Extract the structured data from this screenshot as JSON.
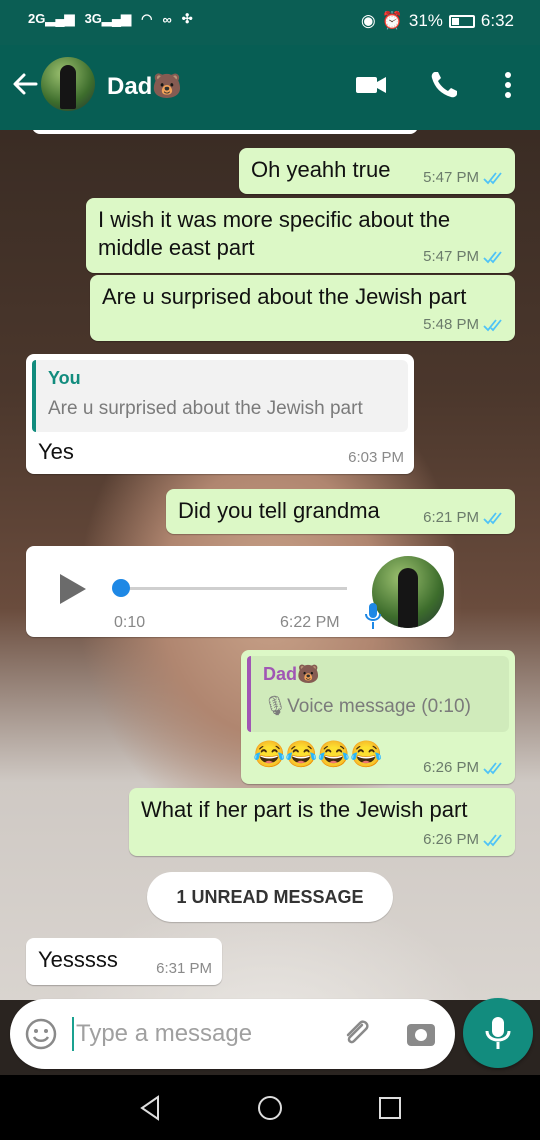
{
  "status_bar": {
    "network_left": "2G",
    "network_right": "3G",
    "battery": "31%",
    "time": "6:32"
  },
  "header": {
    "contact_name": "Dad🐻"
  },
  "messages": [
    {
      "text": "Oh yeahh true",
      "time": "5:47 PM"
    },
    {
      "text_line1": "I wish it was more specific about the",
      "text_line2": "middle east part",
      "time": "5:47 PM"
    },
    {
      "text": "Are u surprised about the Jewish part",
      "time": "5:48 PM"
    },
    {
      "quote_name": "You",
      "quote_text": "Are u surprised about the Jewish part",
      "text": "Yes",
      "time": "6:03 PM"
    },
    {
      "text": "Did you tell grandma",
      "time": "6:21 PM"
    },
    {
      "duration": "0:10",
      "time": "6:22 PM",
      "progress": 0
    },
    {
      "quote_name": "Dad🐻",
      "quote_text": "Voice message (0:10)",
      "text": "😂😂😂😂",
      "time": "6:26 PM"
    },
    {
      "text": "What if her part is the Jewish part",
      "time": "6:26 PM"
    },
    {
      "text": "Yesssss",
      "time": "6:31 PM"
    }
  ],
  "unread_banner": "1 UNREAD MESSAGE",
  "input": {
    "placeholder": "Type a message",
    "value": ""
  },
  "colors": {
    "header": "#075e54",
    "outgoing_bubble": "#dcf8c6",
    "incoming_bubble": "#ffffff",
    "read_ticks": "#4fc3f7",
    "accent": "#128c7e"
  }
}
